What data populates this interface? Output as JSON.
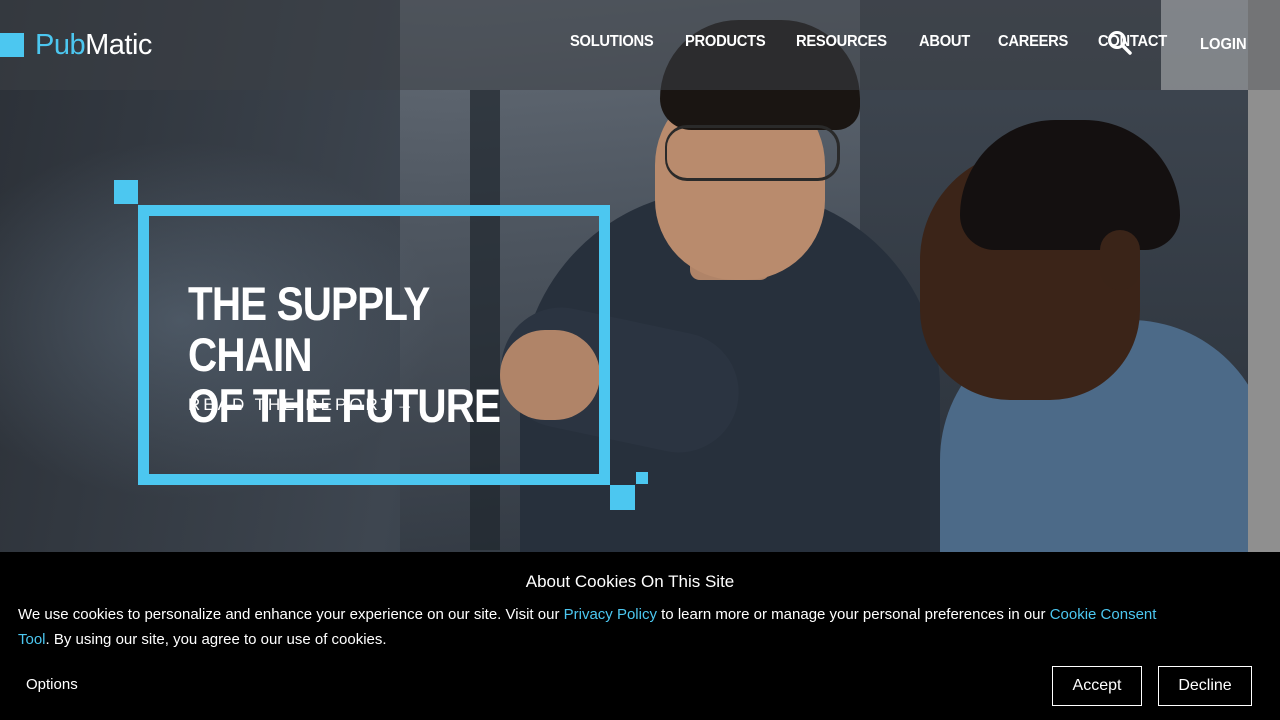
{
  "brand": {
    "logo_part1": "Pub",
    "logo_part2": "Matic",
    "accent_color": "#4cc7f0"
  },
  "nav": {
    "items": [
      "SOLUTIONS",
      "PRODUCTS",
      "RESOURCES",
      "ABOUT",
      "CAREERS",
      "CONTACT"
    ],
    "search_icon": "search-icon",
    "login_label": "LOGIN"
  },
  "hero": {
    "title_line1": "THE SUPPLY CHAIN",
    "title_line2": "OF THE FUTURE",
    "cta_label": "READ THE REPORT",
    "cta_icon": "arrow-right-icon"
  },
  "cookie_banner": {
    "title": "About Cookies On This Site",
    "text_before_privacy": "We use cookies to personalize and enhance your experience on our site. Visit our ",
    "privacy_link": "Privacy Policy",
    "text_middle": " to learn more or manage your personal preferences in our ",
    "consent_link": "Cookie Consent Tool",
    "text_after": ". By using our site, you agree to our use of cookies.",
    "options_label": "Options",
    "accept_label": "Accept",
    "decline_label": "Decline"
  }
}
